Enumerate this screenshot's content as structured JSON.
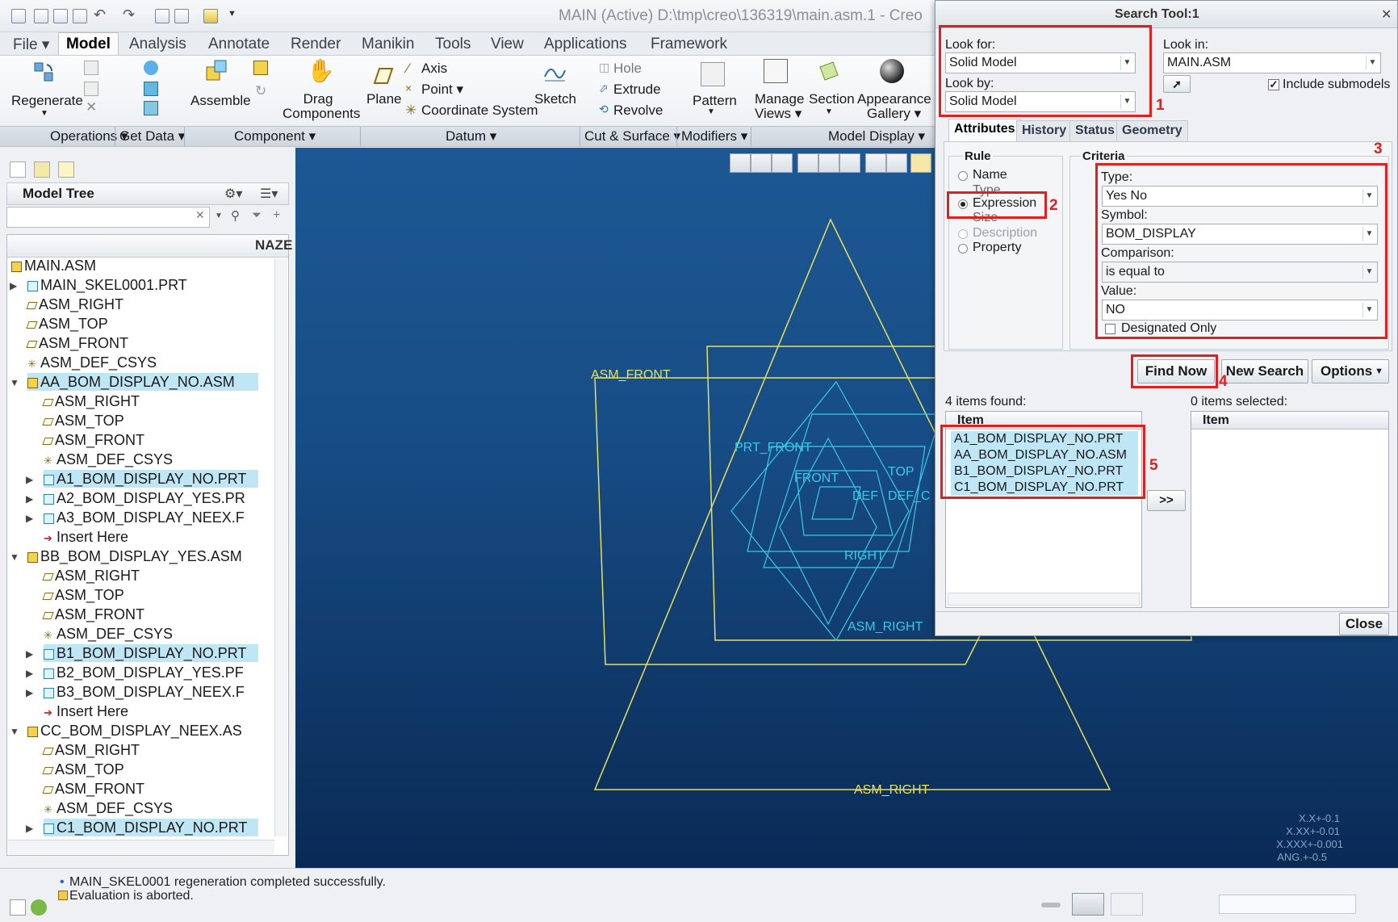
{
  "window": {
    "title": "MAIN (Active) D:\\tmp\\creo\\136319\\main.asm.1 - Creo"
  },
  "menus": [
    "File",
    "Model",
    "Analysis",
    "Annotate",
    "Render",
    "Manikin",
    "Tools",
    "View",
    "Applications",
    "Framework"
  ],
  "ribbon": {
    "regenerate": "Regenerate",
    "assemble": "Assemble",
    "drag1": "Drag",
    "drag2": "Components",
    "plane": "Plane",
    "axis": "Axis",
    "point": "Point",
    "csys": "Coordinate System",
    "sketch": "Sketch",
    "hole": "Hole",
    "extrude": "Extrude",
    "revolve": "Revolve",
    "pattern": "Pattern",
    "manage1": "Manage",
    "manage2": "Views",
    "section": "Section",
    "appear1": "Appearance",
    "appear2": "Gallery"
  },
  "groups": [
    "Operations",
    "Get Data",
    "Component",
    "Datum",
    "Cut & Surface",
    "Modifiers",
    "Model Display"
  ],
  "model_tree": {
    "title": "Model Tree",
    "column": "NAZE",
    "items": [
      {
        "label": "MAIN.ASM",
        "selected": false
      },
      {
        "label": "MAIN_SKEL0001.PRT",
        "selected": false
      },
      {
        "label": "ASM_RIGHT",
        "selected": false
      },
      {
        "label": "ASM_TOP",
        "selected": false
      },
      {
        "label": "ASM_FRONT",
        "selected": false
      },
      {
        "label": "ASM_DEF_CSYS",
        "selected": false
      },
      {
        "label": "AA_BOM_DISPLAY_NO.ASM",
        "selected": true
      },
      {
        "label": "ASM_RIGHT",
        "selected": false
      },
      {
        "label": "ASM_TOP",
        "selected": false
      },
      {
        "label": "ASM_FRONT",
        "selected": false
      },
      {
        "label": "ASM_DEF_CSYS",
        "selected": false
      },
      {
        "label": "A1_BOM_DISPLAY_NO.PRT",
        "selected": true
      },
      {
        "label": "A2_BOM_DISPLAY_YES.PR",
        "selected": false
      },
      {
        "label": "A3_BOM_DISPLAY_NEEX.F",
        "selected": false
      },
      {
        "label": "Insert Here",
        "selected": false
      },
      {
        "label": "BB_BOM_DISPLAY_YES.ASM",
        "selected": false
      },
      {
        "label": "ASM_RIGHT",
        "selected": false
      },
      {
        "label": "ASM_TOP",
        "selected": false
      },
      {
        "label": "ASM_FRONT",
        "selected": false
      },
      {
        "label": "ASM_DEF_CSYS",
        "selected": false
      },
      {
        "label": "B1_BOM_DISPLAY_NO.PRT",
        "selected": true
      },
      {
        "label": "B2_BOM_DISPLAY_YES.PF",
        "selected": false
      },
      {
        "label": "B3_BOM_DISPLAY_NEEX.F",
        "selected": false
      },
      {
        "label": "Insert Here",
        "selected": false
      },
      {
        "label": "CC_BOM_DISPLAY_NEEX.AS",
        "selected": false
      },
      {
        "label": "ASM_RIGHT",
        "selected": false
      },
      {
        "label": "ASM_TOP",
        "selected": false
      },
      {
        "label": "ASM_FRONT",
        "selected": false
      },
      {
        "label": "ASM_DEF_CSYS",
        "selected": false
      },
      {
        "label": "C1_BOM_DISPLAY_NO.PRT",
        "selected": true
      }
    ]
  },
  "viewport_labels": {
    "asm_front": "ASM_FRONT",
    "asm_right": "ASM_RIGHT",
    "front": "FRONT",
    "top": "TOP",
    "right": "RIGHT",
    "csys": "DEF_C",
    "asm_right_inner": "ASM_RIGHT",
    "prt_front": "PRT_FRONT",
    "def": "DEF"
  },
  "tolerances": [
    "X.X+-0.1",
    "X.XX+-0.01",
    "X.XXX+-0.001",
    "ANG.+-0.5"
  ],
  "status": {
    "line1": "MAIN_SKEL0001 regeneration completed successfully.",
    "line2": "Evaluation is aborted."
  },
  "dialog": {
    "title": "Search Tool:1",
    "look_for_label": "Look for:",
    "look_for": "Solid Model",
    "look_by_label": "Look by:",
    "look_by": "Solid Model",
    "look_in_label": "Look in:",
    "look_in": "MAIN.ASM",
    "include_submodels": "Include submodels",
    "tabs": [
      "Attributes",
      "History",
      "Status",
      "Geometry"
    ],
    "rule_title": "Rule",
    "rules": [
      "Name",
      "Type",
      "Expression",
      "Size",
      "Description",
      "Property"
    ],
    "criteria_title": "Criteria",
    "type_label": "Type:",
    "type": "Yes No",
    "symbol_label": "Symbol:",
    "symbol": "BOM_DISPLAY",
    "comparison_label": "Comparison:",
    "comparison": "is equal to",
    "value_label": "Value:",
    "value": "NO",
    "designated_only": "Designated Only",
    "find_now": "Find Now",
    "new_search": "New Search",
    "options": "Options",
    "found_count": "4 items found:",
    "selected_count": "0 items selected:",
    "item_col": "Item",
    "found_items": [
      "A1_BOM_DISPLAY_NO.PRT",
      "AA_BOM_DISPLAY_NO.ASM",
      "B1_BOM_DISPLAY_NO.PRT",
      "C1_BOM_DISPLAY_NO.PRT"
    ],
    "transfer": ">>",
    "close": "Close"
  },
  "annotations": [
    "1",
    "2",
    "3",
    "4",
    "5"
  ]
}
